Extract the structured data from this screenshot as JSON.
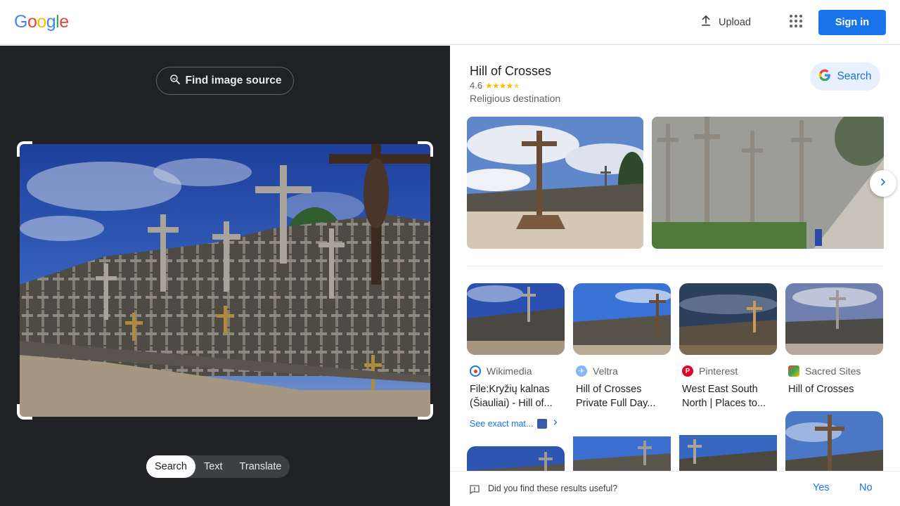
{
  "header": {
    "logo_letters": [
      "G",
      "o",
      "o",
      "g",
      "l",
      "e"
    ],
    "logo_colors": [
      "#4285f4",
      "#ea4335",
      "#fbbc05",
      "#4285f4",
      "#34a853",
      "#ea4335"
    ],
    "upload_label": "Upload",
    "upload_icon": "upload-icon",
    "apps_icon": "apps-grid-icon",
    "signin_label": "Sign in"
  },
  "lens": {
    "find_source_label": "Find image source",
    "find_source_icon": "image-search-icon",
    "tabs": [
      {
        "label": "Search",
        "active": true
      },
      {
        "label": "Text",
        "active": false
      },
      {
        "label": "Translate",
        "active": false
      }
    ]
  },
  "knowledge_panel": {
    "title": "Hill of Crosses",
    "rating": "4.6",
    "stars_filled": 4.5,
    "subtitle": "Religious destination",
    "search_label": "Search",
    "search_icon": "google-g-icon"
  },
  "results": [
    {
      "source": "Wikimedia",
      "title": "File:Kryžių kalnas (Šiauliai) - Hill of...",
      "icon_color": "#1a73e8"
    },
    {
      "source": "Veltra",
      "title": "Hill of Crosses Private Full Day...",
      "icon_color": "#8ab4f8"
    },
    {
      "source": "Pinterest",
      "title": "West East South North | Places to...",
      "icon_color": "#e60023"
    },
    {
      "source": "Sacred Sites",
      "title": "Hill of Crosses",
      "icon_color": "#34a853"
    }
  ],
  "see_exact_matches": "See exact mat...",
  "feedback": {
    "question": "Did you find these results useful?",
    "yes": "Yes",
    "no": "No"
  },
  "colors": {
    "accent": "#1a73e8",
    "dark_bg": "#202124",
    "star": "#fbbc04"
  }
}
